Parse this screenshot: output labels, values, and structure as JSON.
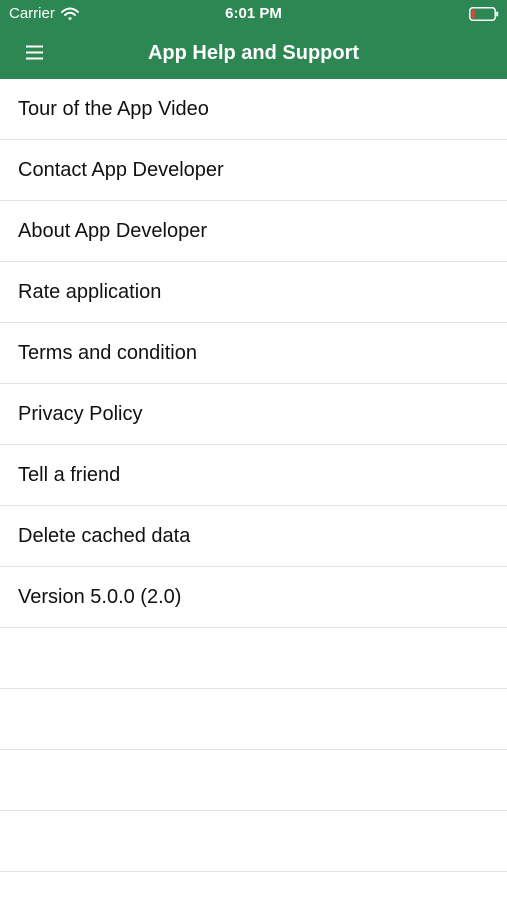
{
  "status_bar": {
    "carrier": "Carrier",
    "time": "6:01 PM",
    "wifi_icon": "wifi-icon",
    "battery_icon": "battery-low-icon",
    "battery_color": "#e0463b"
  },
  "nav": {
    "title": "App Help and Support",
    "menu_icon": "hamburger-menu-icon",
    "background": "#2d8752"
  },
  "menu": {
    "items": [
      {
        "label": "Tour of the App Video"
      },
      {
        "label": "Contact App Developer"
      },
      {
        "label": "About App Developer"
      },
      {
        "label": "Rate application"
      },
      {
        "label": "Terms and condition"
      },
      {
        "label": "Privacy Policy"
      },
      {
        "label": "Tell a friend"
      },
      {
        "label": "Delete cached data"
      },
      {
        "label": "Version 5.0.0 (2.0)"
      }
    ]
  }
}
